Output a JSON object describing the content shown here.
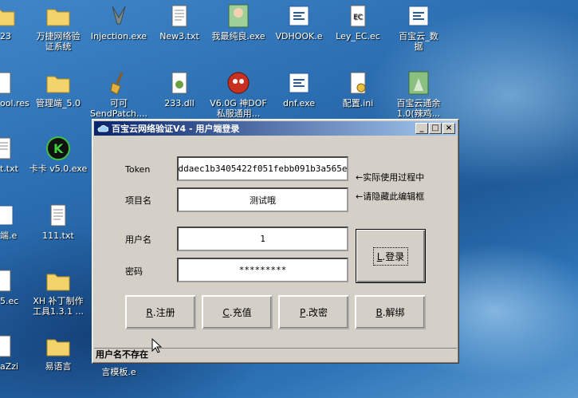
{
  "desktop": {
    "icons": [
      {
        "id": "i1",
        "l1": "23",
        "l2": ""
      },
      {
        "id": "i2",
        "l1": "万捷网络验",
        "l2": "证系统"
      },
      {
        "id": "i3",
        "l1": "Injection.exe",
        "l2": ""
      },
      {
        "id": "i4",
        "l1": "New3.txt",
        "l2": ""
      },
      {
        "id": "i5",
        "l1": "我最纯良.exe",
        "l2": ""
      },
      {
        "id": "i6",
        "l1": "VDHOOK.e",
        "l2": ""
      },
      {
        "id": "i7",
        "l1": "Ley_EC.ec",
        "l2": ""
      },
      {
        "id": "i8",
        "l1": "百宝云_数",
        "l2": "据"
      },
      {
        "id": "i9",
        "l1": "ool.res",
        "l2": ""
      },
      {
        "id": "i10",
        "l1": "管理端_5.0",
        "l2": ""
      },
      {
        "id": "i11",
        "l1": "可可",
        "l2": "SendPatch...."
      },
      {
        "id": "i12",
        "l1": "233.dll",
        "l2": ""
      },
      {
        "id": "i13",
        "l1": "V6.0G 神DOF",
        "l2": "私服通用..."
      },
      {
        "id": "i14",
        "l1": "dnf.exe",
        "l2": ""
      },
      {
        "id": "i15",
        "l1": "配置.ini",
        "l2": ""
      },
      {
        "id": "i16",
        "l1": "百宝云通余",
        "l2": "1.0(辣鸡..."
      },
      {
        "id": "i17",
        "l1": "t.txt",
        "l2": ""
      },
      {
        "id": "i18",
        "l1": "卡卡 v5.0.exe",
        "l2": ""
      },
      {
        "id": "i19",
        "l1": "端.e",
        "l2": ""
      },
      {
        "id": "i20",
        "l1": "111.txt",
        "l2": ""
      },
      {
        "id": "i21",
        "l1": "5.ec",
        "l2": ""
      },
      {
        "id": "i22",
        "l1": "XH 补丁制作",
        "l2": "工具1.3.1 ..."
      },
      {
        "id": "i23",
        "l1": "aZzi",
        "l2": ""
      },
      {
        "id": "i24",
        "l1": "易语言",
        "l2": ""
      },
      {
        "id": "i25",
        "l1": "言模板.e",
        "l2": ""
      }
    ]
  },
  "window": {
    "title": "百宝云网络验证V4 - 用户端登录",
    "controls": {
      "minimize": "_",
      "maximize": "□",
      "close": "×"
    },
    "token_label": "Token",
    "token_value": "ddaec1b3405422f051febb091b3a565e",
    "project_label": "项目名",
    "project_value": "测试哦",
    "user_label": "用户名",
    "user_value": "1",
    "password_label": "密码",
    "password_value": "*********",
    "note1": "←实际使用过程中",
    "note2": "←请隐藏此编辑框",
    "login_btn": {
      "key": "L",
      "text": ".登录"
    },
    "register_btn": {
      "key": "R",
      "text": ".注册"
    },
    "recharge_btn": {
      "key": "C",
      "text": ".充值"
    },
    "changepw_btn": {
      "key": "P",
      "text": ".改密"
    },
    "unbind_btn": {
      "key": "B",
      "text": ".解绑"
    },
    "status": "用户名不存在"
  },
  "colors": {
    "titlebar_start": "#0a246a",
    "titlebar_end": "#a6caf0",
    "window_face": "#d4d0c8"
  }
}
